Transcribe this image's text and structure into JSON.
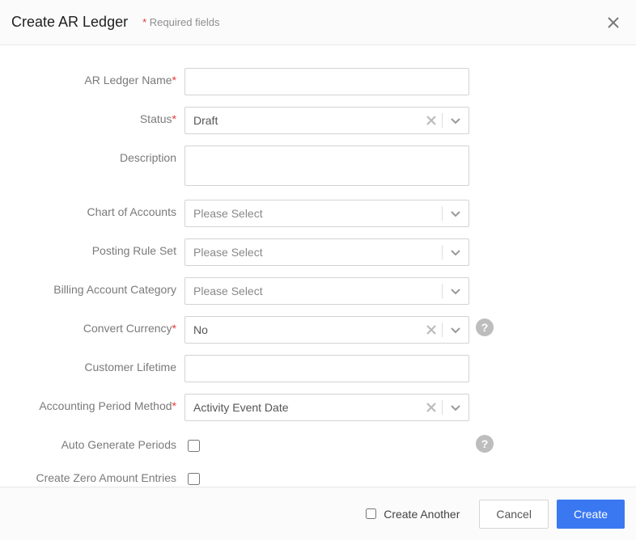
{
  "header": {
    "title": "Create AR Ledger",
    "required_note": "Required fields"
  },
  "fields": {
    "ar_ledger_name": {
      "label": "AR Ledger Name",
      "required": true,
      "value": ""
    },
    "status": {
      "label": "Status",
      "required": true,
      "value": "Draft",
      "clearable": true
    },
    "description": {
      "label": "Description",
      "required": false,
      "value": ""
    },
    "chart_of_accounts": {
      "label": "Chart of Accounts",
      "required": false,
      "value": "",
      "placeholder": "Please Select"
    },
    "posting_rule_set": {
      "label": "Posting Rule Set",
      "required": false,
      "value": "",
      "placeholder": "Please Select"
    },
    "billing_account_category": {
      "label": "Billing Account Category",
      "required": false,
      "value": "",
      "placeholder": "Please Select"
    },
    "convert_currency": {
      "label": "Convert Currency",
      "required": true,
      "value": "No",
      "clearable": true,
      "help": true
    },
    "customer_lifetime": {
      "label": "Customer Lifetime",
      "required": false,
      "value": ""
    },
    "accounting_period_method": {
      "label": "Accounting Period Method",
      "required": true,
      "value": "Activity Event Date",
      "clearable": true
    },
    "auto_generate_periods": {
      "label": "Auto Generate Periods",
      "required": false,
      "checked": false,
      "help": true
    },
    "create_zero_amount_entries": {
      "label": "Create Zero Amount Entries",
      "required": false,
      "checked": false
    }
  },
  "footer": {
    "create_another_label": "Create Another",
    "cancel_label": "Cancel",
    "create_label": "Create"
  }
}
